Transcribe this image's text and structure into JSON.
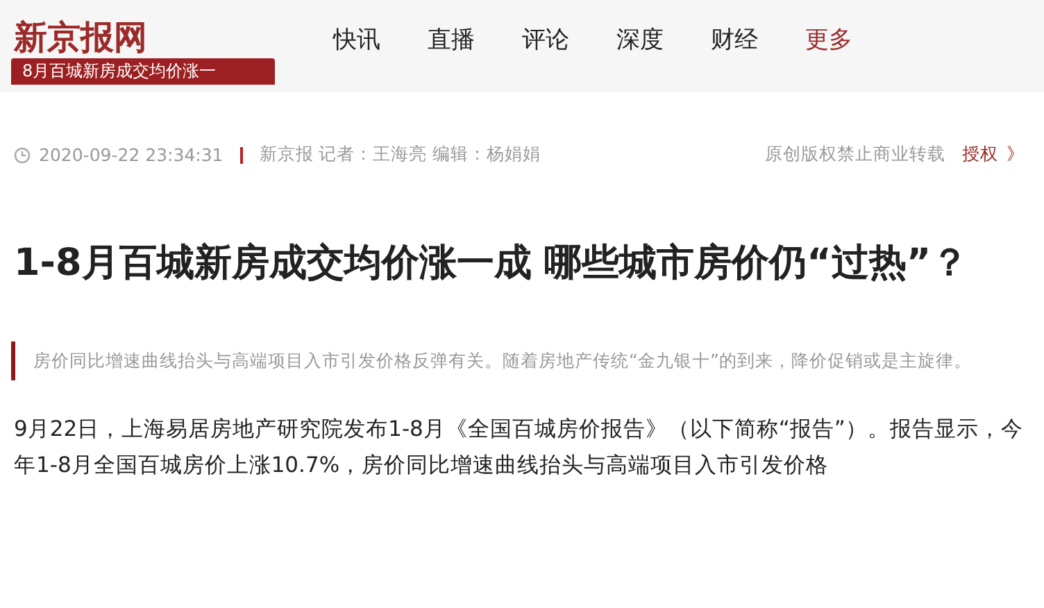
{
  "header": {
    "logo": "新京报网",
    "tag": "8月百城新房成交均价涨一",
    "nav": [
      {
        "label": "快讯",
        "kind": "link"
      },
      {
        "label": "直播",
        "kind": "link"
      },
      {
        "label": "评论",
        "kind": "link"
      },
      {
        "label": "深度",
        "kind": "link"
      },
      {
        "label": "财经",
        "kind": "link"
      },
      {
        "label": "更多",
        "kind": "more"
      }
    ]
  },
  "meta": {
    "time": "2020-09-22 23:34:31",
    "source": "新京报 记者：王海亮 编辑：杨娟娟",
    "copyright": "原创版权禁止商业转载",
    "license_link": "授权",
    "license_arrow": "》"
  },
  "article": {
    "title": "1-8月百城新房成交均价涨一成 哪些城市房价仍“过热”？",
    "summary": "房价同比增速曲线抬头与高端项目入市引发价格反弹有关。随着房地产传统“金九银十”的到来，降价促销或是主旋律。",
    "paragraphs": [
      "9月22日，上海易居房地产研究院发布1-8月《全国百城房价报告》（以下简称“报告”）。报告显示，今年1-8月全国百城房价上涨10.7%，房价同比增速曲线抬头与高端项目入市引发价格"
    ]
  }
}
